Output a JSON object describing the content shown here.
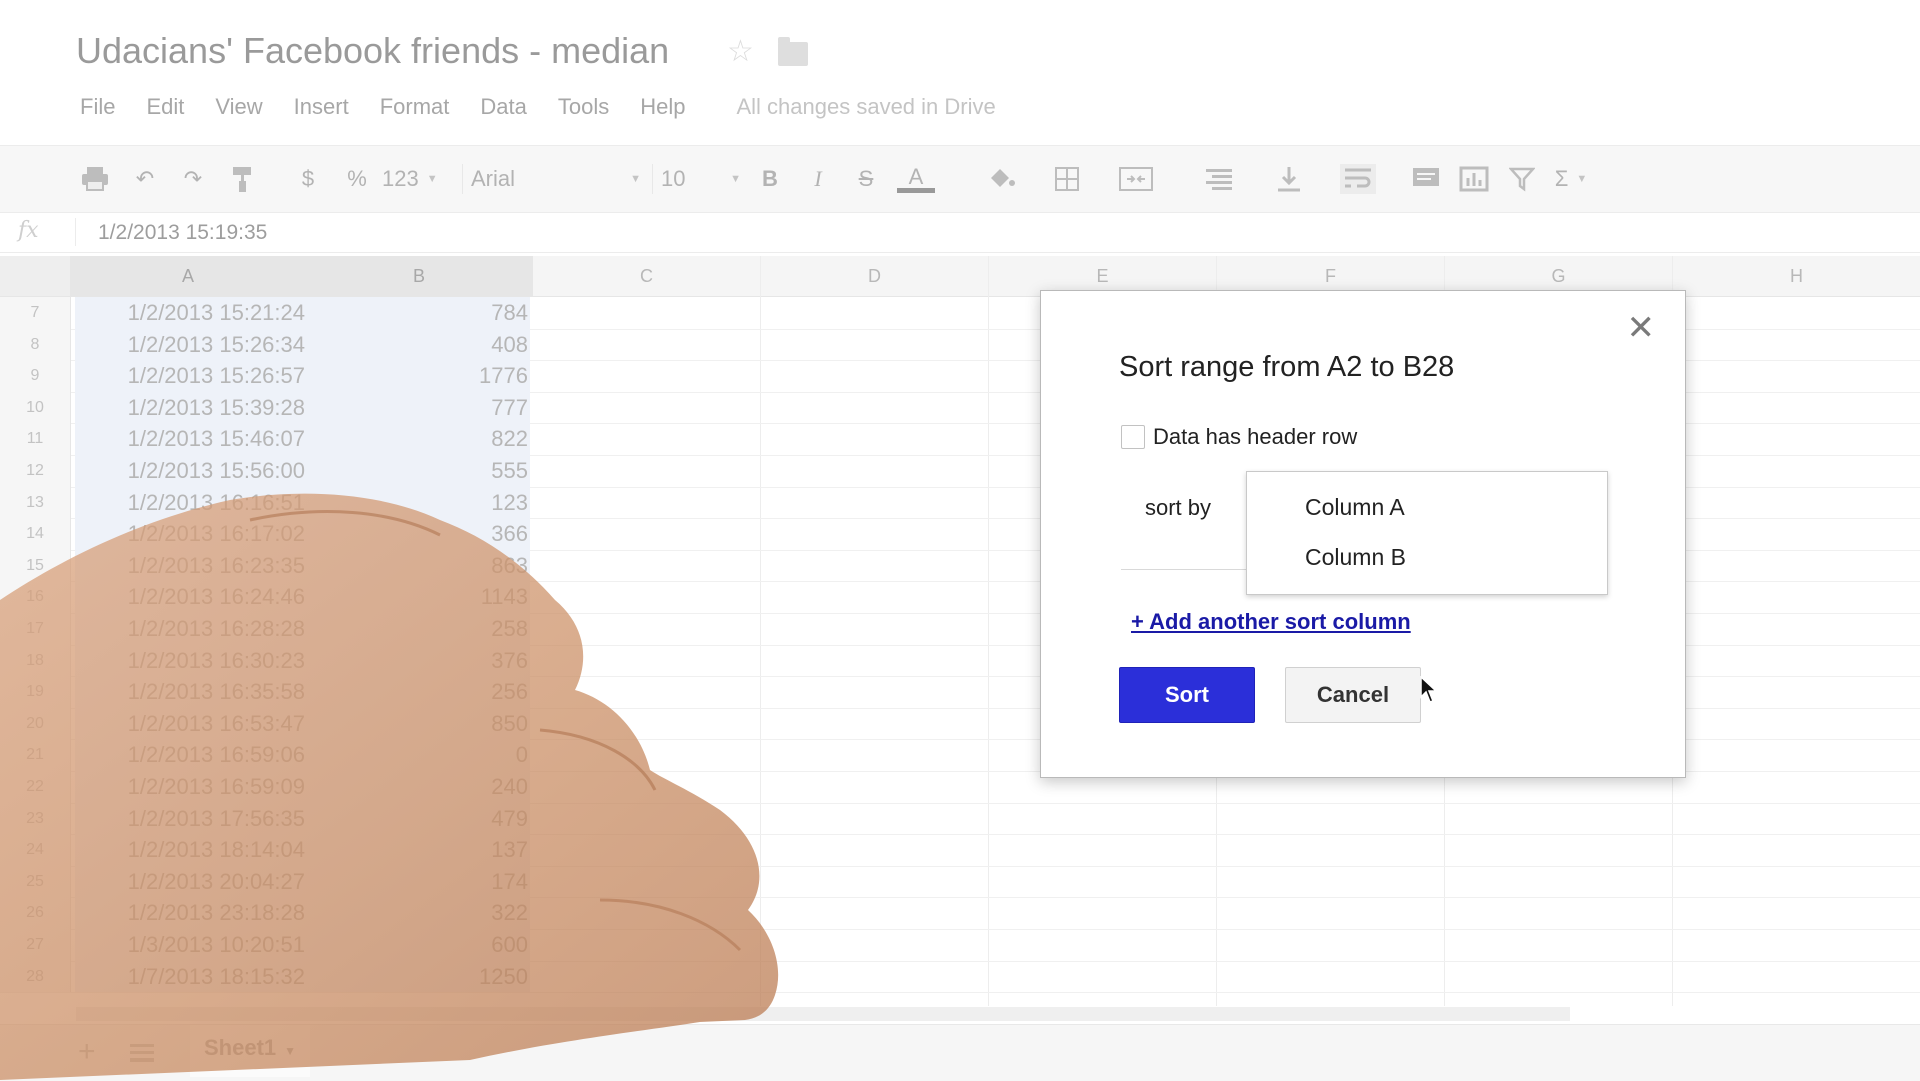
{
  "document": {
    "title": "Udacians' Facebook friends - median"
  },
  "menu": [
    "File",
    "Edit",
    "View",
    "Insert",
    "Format",
    "Data",
    "Tools",
    "Help"
  ],
  "save_status": "All changes saved in Drive",
  "toolbar": {
    "currency": "$",
    "percent": "%",
    "number_format": "123",
    "font": "Arial",
    "font_size": "10",
    "bold": "B",
    "italic": "I",
    "strikethrough": "S",
    "text_color": "A",
    "sum": "Σ"
  },
  "formula_bar": {
    "label": "fx",
    "value": "1/2/2013 15:19:35"
  },
  "columns": [
    "A",
    "B",
    "C",
    "D",
    "E",
    "F",
    "G",
    "H"
  ],
  "rows": [
    {
      "n": "7",
      "a": "1/2/2013 15:21:24",
      "b": "784"
    },
    {
      "n": "8",
      "a": "1/2/2013 15:26:34",
      "b": "408"
    },
    {
      "n": "9",
      "a": "1/2/2013 15:26:57",
      "b": "1776"
    },
    {
      "n": "10",
      "a": "1/2/2013 15:39:28",
      "b": "777"
    },
    {
      "n": "11",
      "a": "1/2/2013 15:46:07",
      "b": "822"
    },
    {
      "n": "12",
      "a": "1/2/2013 15:56:00",
      "b": "555"
    },
    {
      "n": "13",
      "a": "1/2/2013 16:16:51",
      "b": "123"
    },
    {
      "n": "14",
      "a": "1/2/2013 16:17:02",
      "b": "366"
    },
    {
      "n": "15",
      "a": "1/2/2013 16:23:35",
      "b": "863"
    },
    {
      "n": "16",
      "a": "1/2/2013 16:24:46",
      "b": "1143"
    },
    {
      "n": "17",
      "a": "1/2/2013 16:28:28",
      "b": "258"
    },
    {
      "n": "18",
      "a": "1/2/2013 16:30:23",
      "b": "376"
    },
    {
      "n": "19",
      "a": "1/2/2013 16:35:58",
      "b": "256"
    },
    {
      "n": "20",
      "a": "1/2/2013 16:53:47",
      "b": "850"
    },
    {
      "n": "21",
      "a": "1/2/2013 16:59:06",
      "b": "0"
    },
    {
      "n": "22",
      "a": "1/2/2013 16:59:09",
      "b": "240"
    },
    {
      "n": "23",
      "a": "1/2/2013 17:56:35",
      "b": "479"
    },
    {
      "n": "24",
      "a": "1/2/2013 18:14:04",
      "b": "137"
    },
    {
      "n": "25",
      "a": "1/2/2013 20:04:27",
      "b": "174"
    },
    {
      "n": "26",
      "a": "1/2/2013 23:18:28",
      "b": "322"
    },
    {
      "n": "27",
      "a": "1/3/2013 10:20:51",
      "b": "600"
    },
    {
      "n": "28",
      "a": "1/7/2013 18:15:32",
      "b": "1250"
    }
  ],
  "sheet_tab": "Sheet1",
  "dialog": {
    "title": "Sort range from A2 to B28",
    "header_row_label": "Data has header row",
    "header_row_checked": false,
    "sort_by_label": "sort by",
    "sort_options": [
      "Column A",
      "Column B"
    ],
    "add_sort_column": "+ Add another sort column",
    "sort_button": "Sort",
    "cancel_button": "Cancel",
    "close_icon": "close-icon"
  },
  "colors": {
    "primary_button": "#2b2fd9",
    "link": "#1a1aa6"
  }
}
